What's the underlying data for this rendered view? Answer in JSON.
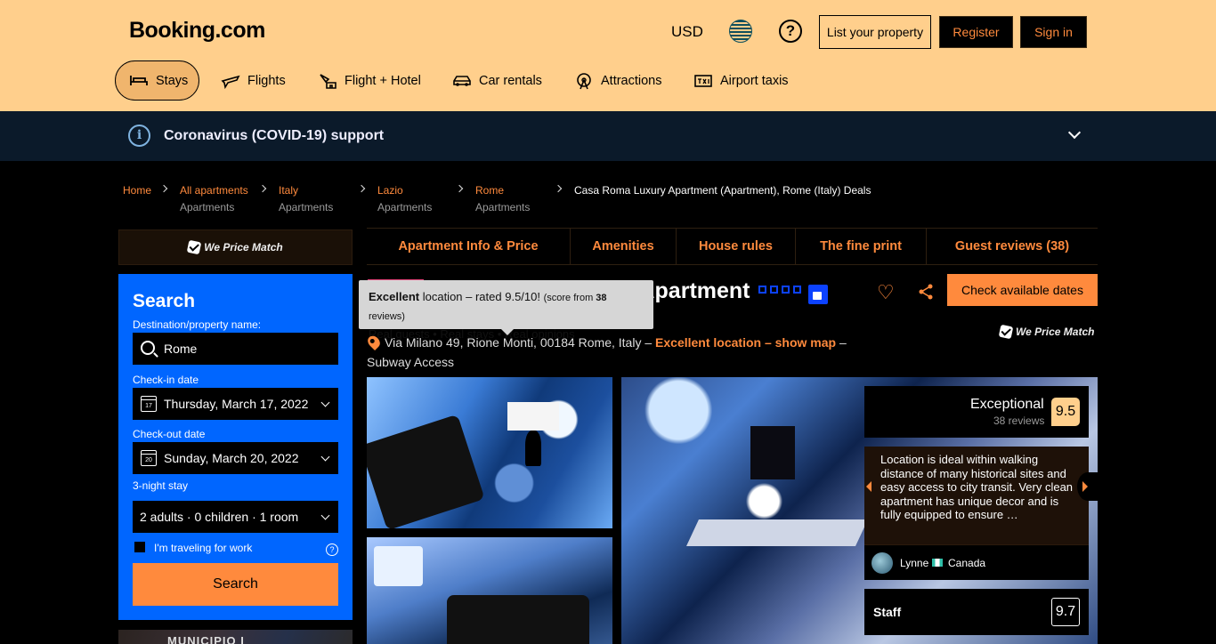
{
  "header": {
    "logo": "Booking.com",
    "currency": "USD",
    "help": "?",
    "list_property": "List your property",
    "register": "Register",
    "sign_in": "Sign in"
  },
  "nav": {
    "stays": "Stays",
    "flights": "Flights",
    "flight_hotel": "Flight + Hotel",
    "car_rentals": "Car rentals",
    "attractions": "Attractions",
    "airport_taxis": "Airport taxis"
  },
  "covid": {
    "icon": "i",
    "text": "Coronavirus (COVID-19) support"
  },
  "breadcrumb": {
    "home": "Home",
    "all_apartments": "All apartments",
    "italy": "Italy",
    "lazio": "Lazio",
    "rome": "Rome",
    "sub_label": "Apartments",
    "current": "Casa Roma Luxury Apartment (Apartment), Rome (Italy) Deals"
  },
  "price_match": "We Price Match",
  "search": {
    "title": "Search",
    "destination_label": "Destination/property name:",
    "destination_value": "Rome",
    "checkin_label": "Check-in date",
    "checkin_value": "Thursday, March 17, 2022",
    "checkin_day": "17",
    "checkout_label": "Check-out date",
    "checkout_value": "Sunday, March 20, 2022",
    "checkout_day": "20",
    "stay_length": "3-night stay",
    "guests_value": "2 adults · 0 children · 1 room",
    "work_label": "I'm traveling for work",
    "work_help": "?",
    "button": "Search"
  },
  "map_label": "MUNICIPIO I",
  "tabs": {
    "info": "Apartment Info & Price",
    "amenities": "Amenities",
    "house_rules": "House rules",
    "fine_print": "The fine print",
    "reviews": "Guest reviews (38)"
  },
  "property": {
    "type": "Apartment",
    "name": "Casa Roma Luxury Apartment",
    "check_dates": "Check available dates",
    "address": "Via Milano 49, Rione Monti, 00184 Rome, Italy –",
    "location_link": "Excellent location – show map",
    "address_suffix": "– Subway Access"
  },
  "tooltip": {
    "bold": "Excellent",
    "text": "location – rated 9.5/10!",
    "small_pre": "(score from",
    "small_num": "38",
    "small_post": "reviews)",
    "line2": "Real guests • Real stays • Real opinions"
  },
  "review": {
    "word": "Exceptional",
    "count": "38 reviews",
    "score": "9.5",
    "text": "Location is ideal within walking distance of many historical sites and easy access to city transit. Very clean apartment has unique decor and is fully equipped to ensure …",
    "user": "Lynne",
    "country": "Canada",
    "staff_label": "Staff",
    "staff_score": "9.7"
  },
  "colors": {
    "header_bg": "#ffcf8c",
    "accent": "#ff8a3d",
    "search_bg": "#0066ff",
    "covid_bg": "#0b1a2a"
  }
}
